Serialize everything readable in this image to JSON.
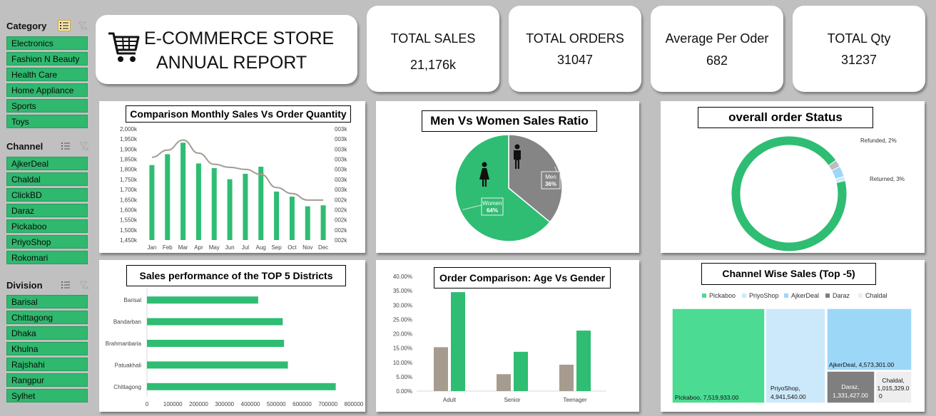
{
  "title": {
    "line1": "E-COMMERCE STORE",
    "line2": "ANNUAL REPORT"
  },
  "kpis": [
    {
      "label": "TOTAL SALES",
      "value": "21,176k"
    },
    {
      "label": "TOTAL ORDERS",
      "value": "31047"
    },
    {
      "label": "Average Per Oder",
      "value": "682"
    },
    {
      "label": "TOTAL Qty",
      "value": "31237"
    }
  ],
  "slicers": {
    "category": {
      "title": "Category",
      "items": [
        "Electronics",
        "Fashion N Beauty",
        "Health Care",
        "Home Appliance",
        "Sports",
        "Toys"
      ]
    },
    "channel": {
      "title": "Channel",
      "items": [
        "AjkerDeal",
        "Chaldal",
        "ClickBD",
        "Daraz",
        "Pickaboo",
        "PriyoShop",
        "Rokomari"
      ]
    },
    "division": {
      "title": "Division",
      "items": [
        "Barisal",
        "Chittagong",
        "Dhaka",
        "Khulna",
        "Rajshahi",
        "Rangpur",
        "Sylhet"
      ]
    }
  },
  "colors": {
    "green": "#2ebd72",
    "grey": "#858585",
    "line": "#a39c94",
    "lightblue": "#cce9fb",
    "blue": "#9dd7f8",
    "darkgrey": "#7f7f7f",
    "palegrey": "#eeeeee",
    "treegreen": "#4cdb93",
    "taupe": "#a69b8f"
  },
  "chart_data": [
    {
      "id": "monthly",
      "type": "bar",
      "title": "Comparison Monthly Sales Vs Order Quantity",
      "categories": [
        "Jan",
        "Feb",
        "Mar",
        "Apr",
        "May",
        "Jun",
        "Jul",
        "Aug",
        "Sep",
        "Oct",
        "Nov",
        "Dec"
      ],
      "series": [
        {
          "type": "bar",
          "values": [
            1821,
            1875,
            1932,
            1829,
            1806,
            1751,
            1778,
            1813,
            1690,
            1665,
            1617,
            1622
          ]
        },
        {
          "type": "line",
          "values": [
            1860,
            1895,
            1945,
            1880,
            1825,
            1810,
            1800,
            1775,
            1710,
            1680,
            1648,
            1648
          ]
        }
      ],
      "ylim": [
        1450,
        2000
      ],
      "yticks": [
        "2,000k",
        "1,950k",
        "1,900k",
        "1,850k",
        "1,800k",
        "1,750k",
        "1,700k",
        "1,650k",
        "1,600k",
        "1,550k",
        "1,500k",
        "1,450k"
      ],
      "y2ticks": [
        "003k",
        "003k",
        "003k",
        "003k",
        "003k",
        "003k",
        "003k",
        "002k",
        "002k",
        "002k",
        "002k",
        "002k"
      ]
    },
    {
      "id": "gender",
      "type": "pie",
      "title": "Men Vs Women Sales Ratio",
      "labels": [
        "Men",
        "Women"
      ],
      "values": [
        36,
        64
      ],
      "value_labels": [
        "36%",
        "64%"
      ]
    },
    {
      "id": "status",
      "type": "pie",
      "title": "overall order Status",
      "labels": [
        "Refunded",
        "Returned",
        ""
      ],
      "values": [
        2,
        3,
        95
      ],
      "value_labels": [
        "Refunded, 2%",
        "Returned, 3%"
      ]
    },
    {
      "id": "districts",
      "type": "bar",
      "title": "Sales performance of the TOP 5 Districts",
      "categories": [
        "Barisal",
        "Bandarban",
        "Brahmanbaria",
        "Patuakhali",
        "Chittagong"
      ],
      "values": [
        430000,
        525000,
        530000,
        545000,
        730000
      ],
      "xlim": [
        0,
        800000
      ],
      "xticks": [
        "0",
        "100000",
        "200000",
        "300000",
        "400000",
        "500000",
        "600000",
        "700000",
        "800000"
      ]
    },
    {
      "id": "agegender",
      "type": "bar",
      "title": "Order Comparison: Age Vs Gender",
      "categories": [
        "Adult",
        "Senior",
        "Teenager"
      ],
      "series": [
        {
          "values": [
            15.3,
            5.9,
            9.2
          ]
        },
        {
          "values": [
            34.5,
            13.7,
            21.1
          ]
        }
      ],
      "ylim": [
        0,
        40
      ],
      "yticks": [
        "40.00%",
        "35.00%",
        "30.00%",
        "25.00%",
        "20.00%",
        "15.00%",
        "10.00%",
        "5.00%",
        "0.00%"
      ]
    },
    {
      "id": "channels",
      "type": "treemap",
      "title": "Channel Wise Sales (Top -5)",
      "legend": [
        "Pickaboo",
        "PriyoShop",
        "AjkerDeal",
        "Daraz",
        "Chaldal"
      ],
      "values": [
        7519933,
        4941540,
        4573301,
        1331427,
        1015329
      ],
      "value_labels": [
        "Pickaboo, 7,519,933.00",
        "PriyoShop, 4,941,540.00",
        "AjkerDeal, 4,573,301.00",
        "Daraz, 1,331,427.00",
        "Chaldal, 1,015,329.00"
      ]
    }
  ]
}
